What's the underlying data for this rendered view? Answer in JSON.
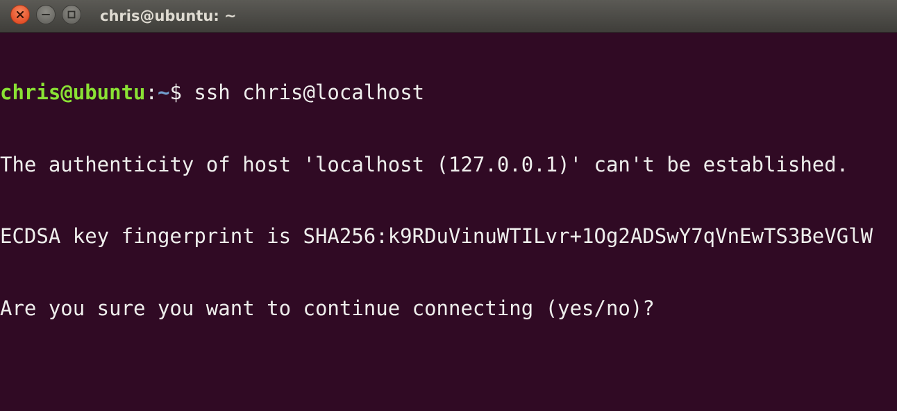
{
  "window": {
    "title": "chris@ubuntu: ~",
    "buttons": {
      "close_icon": "close-icon",
      "minimize_icon": "minimize-icon",
      "maximize_icon": "maximize-icon"
    }
  },
  "terminal": {
    "prompt": {
      "user_host": "chris@ubuntu",
      "separator": ":",
      "path": "~",
      "symbol": "$",
      "command": " ssh chris@localhost"
    },
    "output": [
      "The authenticity of host 'localhost (127.0.0.1)' can't be established.",
      "ECDSA key fingerprint is SHA256:k9RDuVinuWTILvr+1Og2ADSwY7qVnEwTS3BeVGlW",
      "Are you sure you want to continue connecting (yes/no)?"
    ]
  },
  "colors": {
    "background": "#300a24",
    "text": "#eeeeec",
    "prompt_user": "#8ae234",
    "prompt_path": "#729fcf",
    "titlebar": "#4a4945",
    "close_button": "#e95420"
  }
}
